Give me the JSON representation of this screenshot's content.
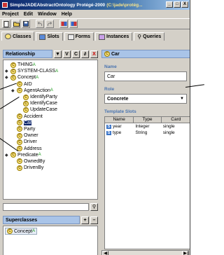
{
  "window": {
    "title": "SimpleJADEAbstractOntology Protégé-2000",
    "title_path": "(C:\\jade\\protég...",
    "min_label": "_",
    "max_label": "□",
    "close_label": "X"
  },
  "menu": [
    "Project",
    "Edit",
    "Window",
    "Help"
  ],
  "tabs": [
    {
      "label": "Classes",
      "active": true
    },
    {
      "label": "Slots",
      "active": false
    },
    {
      "label": "Forms",
      "active": false
    },
    {
      "label": "Instances",
      "active": false
    },
    {
      "label": "Queries",
      "active": false
    }
  ],
  "relationship": {
    "label": "Relationship",
    "dropdown_glyph": "▼",
    "btn_v": "V",
    "btn_c": "C",
    "btn_x": "X"
  },
  "tree": [
    {
      "label": "THING",
      "depth": 0,
      "twisty": "",
      "sup": "A"
    },
    {
      "label": "SYSTEM-CLASS",
      "depth": 0,
      "twisty": "◆",
      "sup": "A"
    },
    {
      "label": "Concept",
      "depth": 0,
      "twisty": "◆",
      "sup": "A"
    },
    {
      "label": "AID",
      "depth": 1,
      "twisty": "",
      "sup": ""
    },
    {
      "label": "AgentAction",
      "depth": 1,
      "twisty": "◆",
      "sup": "A"
    },
    {
      "label": "IdentifyParty",
      "depth": 2,
      "twisty": "",
      "sup": ""
    },
    {
      "label": "IdentifyCase",
      "depth": 2,
      "twisty": "",
      "sup": ""
    },
    {
      "label": "UpdateCase",
      "depth": 2,
      "twisty": "",
      "sup": ""
    },
    {
      "label": "Accident",
      "depth": 1,
      "twisty": "",
      "sup": ""
    },
    {
      "label": "Car",
      "depth": 1,
      "twisty": "",
      "sup": "",
      "selected": true
    },
    {
      "label": "Party",
      "depth": 1,
      "twisty": "",
      "sup": ""
    },
    {
      "label": "Owner",
      "depth": 1,
      "twisty": "",
      "sup": ""
    },
    {
      "label": "Driver",
      "depth": 1,
      "twisty": "",
      "sup": ""
    },
    {
      "label": "Address",
      "depth": 1,
      "twisty": "",
      "sup": ""
    },
    {
      "label": "Predicate",
      "depth": 0,
      "twisty": "◆",
      "sup": "A"
    },
    {
      "label": "OwnedBy",
      "depth": 1,
      "twisty": "",
      "sup": ""
    },
    {
      "label": "DrivenBy",
      "depth": 1,
      "twisty": "",
      "sup": ""
    }
  ],
  "superclasses": {
    "label": "Superclasses",
    "add": "+",
    "remove": "–",
    "items": [
      {
        "label": "Concept",
        "sup": "A"
      }
    ]
  },
  "form": {
    "header": "Car",
    "name_label": "Name",
    "name_value": "Car",
    "role_label": "Role",
    "role_value": "Concrete",
    "template_slots_label": "Template Slots",
    "columns": [
      "Name",
      "Type",
      "Card"
    ],
    "slots": [
      {
        "name": "year",
        "type": "Integer",
        "card": "single"
      },
      {
        "name": "type",
        "type": "String",
        "card": "single"
      }
    ]
  }
}
